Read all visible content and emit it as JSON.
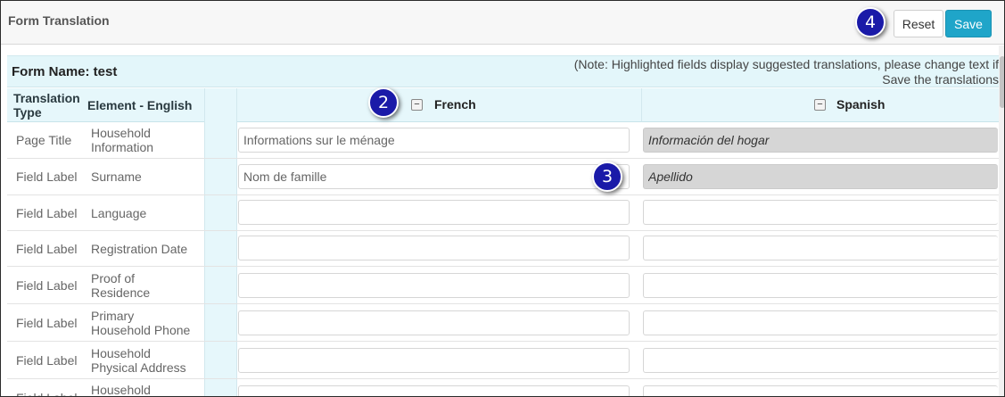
{
  "header": {
    "title": "Form Translation",
    "reset_label": "Reset",
    "save_label": "Save"
  },
  "form": {
    "name_label": "Form Name: test",
    "note_line1": "(Note: Highlighted fields display suggested translations, please change text if",
    "note_line2": "Save the translations"
  },
  "columns": {
    "translation_type_line1": "Translation",
    "translation_type_line2": "Type",
    "element": "Element - English"
  },
  "languages": [
    {
      "name": "French",
      "collapse": "−"
    },
    {
      "name": "Spanish",
      "collapse": "−"
    }
  ],
  "badges": {
    "b2": "2",
    "b3": "3",
    "b4": "4"
  },
  "rows": [
    {
      "type": "Page Title",
      "element_line1": "Household",
      "element_line2": "Information",
      "french": "Informations sur le ménage",
      "spanish": "Información del hogar",
      "spanish_suggested": true
    },
    {
      "type": "Field Label",
      "element_line1": "Surname",
      "element_line2": "",
      "french": "Nom de famille",
      "spanish": "Apellido",
      "spanish_suggested": true
    },
    {
      "type": "Field Label",
      "element_line1": "Language",
      "element_line2": "",
      "french": "",
      "spanish": ""
    },
    {
      "type": "Field Label",
      "element_line1": "Registration Date",
      "element_line2": "",
      "french": "",
      "spanish": ""
    },
    {
      "type": "Field Label",
      "element_line1": "Proof of",
      "element_line2": "Residence",
      "french": "",
      "spanish": ""
    },
    {
      "type": "Field Label",
      "element_line1": "Primary",
      "element_line2": "Household Phone",
      "french": "",
      "spanish": ""
    },
    {
      "type": "Field Label",
      "element_line1": "Household",
      "element_line2": "Physical Address",
      "french": "",
      "spanish": ""
    },
    {
      "type": "Field Label",
      "element_line1": "Household",
      "element_line2": "",
      "french": "",
      "spanish": ""
    }
  ]
}
